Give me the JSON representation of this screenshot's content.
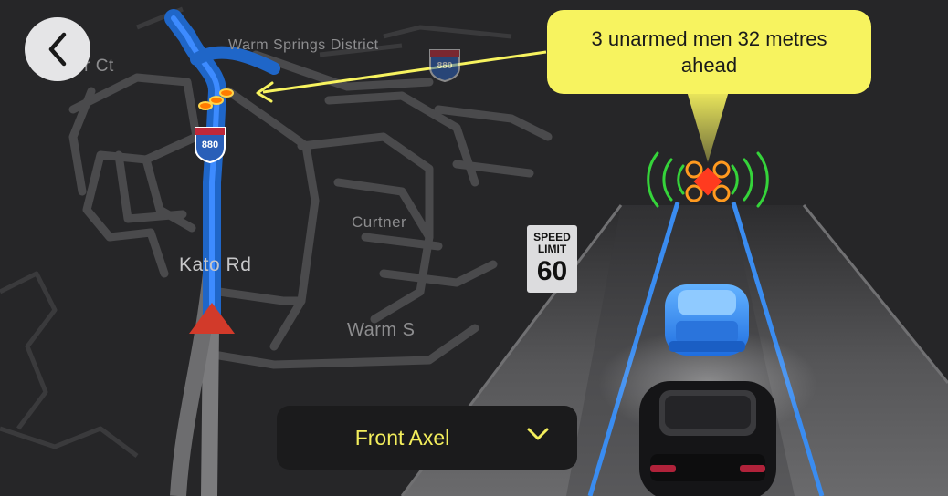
{
  "map": {
    "labels": {
      "warm_springs_district": "Warm Springs District",
      "ct": "ber Ct",
      "kato_rd": "Kato Rd",
      "curtner": "Curtner",
      "warm_s": "Warm S"
    },
    "highway_shield": "880"
  },
  "alert": {
    "message": "3 unarmed men 32 metres ahead"
  },
  "speed_limit": {
    "label_line1": "SPEED",
    "label_line2": "LIMIT",
    "value": "60"
  },
  "axle_selector": {
    "selected": "Front Axel"
  },
  "icons": {
    "back": "chevron-left-icon",
    "dropdown": "chevron-down-icon",
    "target": "target-marker-icon"
  },
  "colors": {
    "accent_yellow": "#f7f35f",
    "route_blue": "#1f66c8",
    "lane_blue": "#3a8cf0",
    "signal_green": "#35d43a",
    "target_red": "#ff3b1f"
  }
}
